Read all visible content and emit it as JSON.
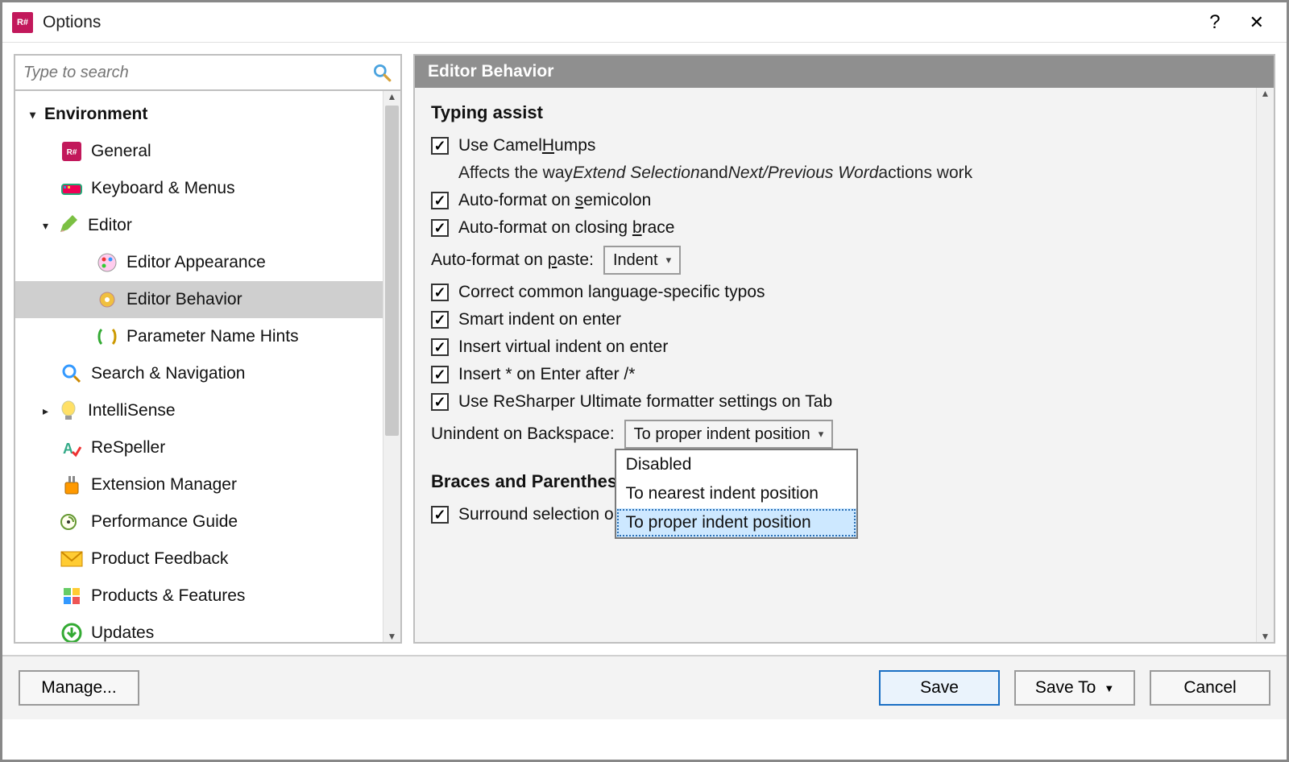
{
  "window": {
    "title": "Options",
    "help_symbol": "?",
    "close_symbol": "✕"
  },
  "search": {
    "placeholder": "Type to search"
  },
  "tree": {
    "root": "Environment",
    "items": [
      {
        "label": "General",
        "level": 1,
        "icon": "app"
      },
      {
        "label": "Keyboard & Menus",
        "level": 1,
        "icon": "kbd"
      },
      {
        "label": "Editor",
        "level": 1,
        "icon": "pencil",
        "caret": "down"
      },
      {
        "label": "Editor Appearance",
        "level": 2,
        "icon": "palette"
      },
      {
        "label": "Editor Behavior",
        "level": 2,
        "icon": "gear",
        "selected": true
      },
      {
        "label": "Parameter Name Hints",
        "level": 2,
        "icon": "param"
      },
      {
        "label": "Search & Navigation",
        "level": 1,
        "icon": "search"
      },
      {
        "label": "IntelliSense",
        "level": 1,
        "icon": "bulb",
        "caret": "right"
      },
      {
        "label": "ReSpeller",
        "level": 1,
        "icon": "respell"
      },
      {
        "label": "Extension Manager",
        "level": 1,
        "icon": "ext"
      },
      {
        "label": "Performance Guide",
        "level": 1,
        "icon": "perf"
      },
      {
        "label": "Product Feedback",
        "level": 1,
        "icon": "mail"
      },
      {
        "label": "Products & Features",
        "level": 1,
        "icon": "grid"
      },
      {
        "label": "Updates",
        "level": 1,
        "icon": "update"
      }
    ]
  },
  "content": {
    "header": "Editor Behavior",
    "typing": {
      "title": "Typing assist",
      "camel_label_pre": "Use Camel",
      "camel_label_h": "H",
      "camel_label_post": "umps",
      "camel_hint_pre": "Affects the way ",
      "camel_hint_i1": "Extend Selection",
      "camel_hint_mid": " and ",
      "camel_hint_i2": "Next/Previous Word",
      "camel_hint_post": " actions work",
      "semi_pre": "Auto-format on ",
      "semi_s": "s",
      "semi_post": "emicolon",
      "brace_pre": "Auto-format on closing ",
      "brace_b": "b",
      "brace_post": "race",
      "paste_pre": "Auto-format on ",
      "paste_p": "p",
      "paste_post": "aste:",
      "paste_value": "Indent",
      "typos": "Correct common language-specific typos",
      "smart": "Smart indent on enter",
      "virtual": "Insert virtual indent on enter",
      "star": "Insert * on Enter after /*",
      "tab": "Use ReSharper Ultimate formatter settings on Tab",
      "unindent_label": "Unindent on Backspace:",
      "unindent_value": "To proper indent position",
      "unindent_options": [
        "Disabled",
        "To nearest indent position",
        "To proper indent position"
      ]
    },
    "braces": {
      "title": "Braces and Parentheses",
      "surround": "Surround selection on"
    }
  },
  "footer": {
    "manage": "Manage...",
    "save": "Save",
    "save_to": "Save To",
    "cancel": "Cancel"
  }
}
